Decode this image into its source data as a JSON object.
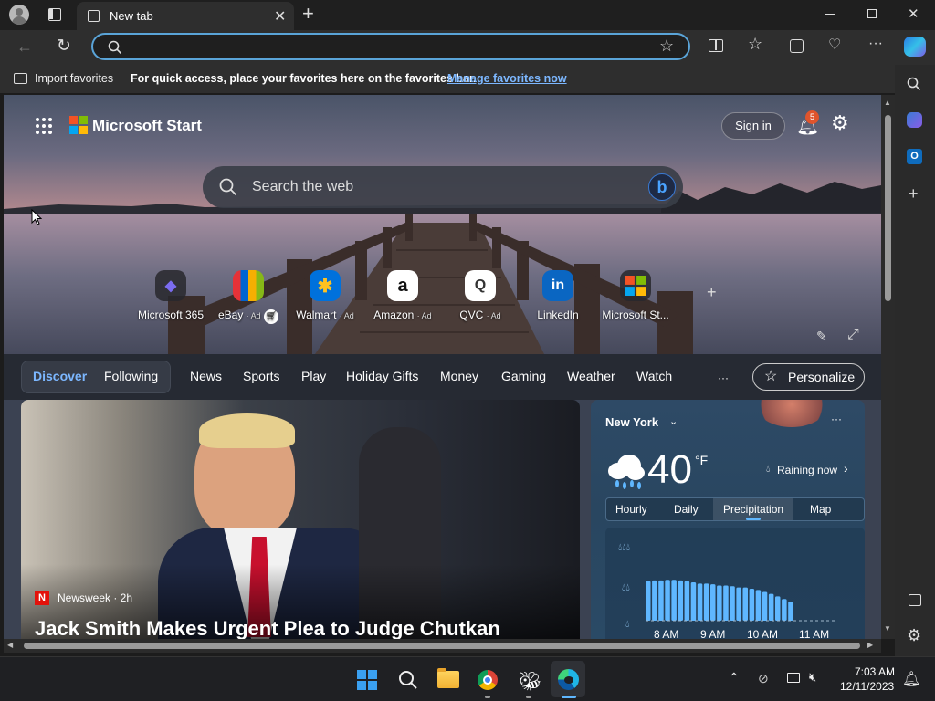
{
  "browser": {
    "tab_title": "New tab",
    "address_value": "",
    "favorites_bar": {
      "import_label": "Import favorites",
      "message": "For quick access, place your favorites here on the favorites bar.",
      "manage_link": "Manage favorites now"
    }
  },
  "start": {
    "brand": "Microsoft Start",
    "sign_in": "Sign in",
    "notification_count": "5",
    "search_placeholder": "Search the web",
    "quick_links": [
      {
        "name": "Microsoft 365",
        "ad": "",
        "icon": "microsoft365-icon",
        "glyph": "◆",
        "color": "#7b6cf0"
      },
      {
        "name": "eBay",
        "ad": "· Ad",
        "icon": "ebay-icon",
        "glyph": "▣",
        "color": "#e53238"
      },
      {
        "name": "Walmart",
        "ad": "· Ad",
        "icon": "walmart-icon",
        "glyph": "✱",
        "color": "#ffc220"
      },
      {
        "name": "Amazon",
        "ad": "· Ad",
        "icon": "amazon-icon",
        "glyph": "a",
        "color": "#ffffff"
      },
      {
        "name": "QVC",
        "ad": "· Ad",
        "icon": "qvc-icon",
        "glyph": "Q",
        "color": "#ffffff"
      },
      {
        "name": "LinkedIn",
        "ad": "",
        "icon": "linkedin-icon",
        "glyph": "in",
        "color": "#ffffff"
      },
      {
        "name": "Microsoft St...",
        "ad": "",
        "icon": "microsoft-store-icon",
        "glyph": "▦",
        "color": "#f35325"
      }
    ],
    "nav": {
      "discover": "Discover",
      "following": "Following",
      "items": [
        "News",
        "Sports",
        "Play",
        "Holiday Gifts",
        "Money",
        "Gaming",
        "Weather",
        "Watch"
      ],
      "more": "···",
      "personalize": "Personalize"
    },
    "news": {
      "source": "Newsweek · 2h",
      "headline": "Jack Smith Makes Urgent Plea to Judge Chutkan"
    },
    "weather": {
      "city": "New York",
      "temp": "40",
      "unit": "°F",
      "status": "Raining now",
      "tabs": [
        "Hourly",
        "Daily",
        "Precipitation",
        "Map"
      ],
      "active_tab": "Precipitation",
      "times": [
        "8 AM",
        "9 AM",
        "10 AM",
        "11 AM"
      ],
      "precip_levels": [
        0.62,
        0.63,
        0.63,
        0.64,
        0.64,
        0.63,
        0.62,
        0.6,
        0.58,
        0.58,
        0.57,
        0.55,
        0.55,
        0.54,
        0.52,
        0.52,
        0.5,
        0.48,
        0.45,
        0.42,
        0.38,
        0.34,
        0.3
      ]
    }
  },
  "taskbar": {
    "time": "7:03 AM",
    "date": "12/11/2023"
  }
}
